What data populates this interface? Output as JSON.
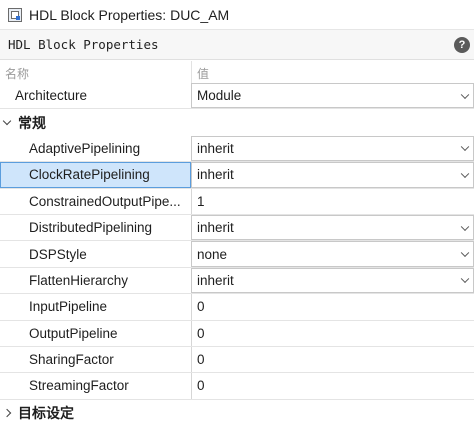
{
  "window": {
    "title": "HDL Block Properties: DUC_AM",
    "icon": "block-properties-app-icon"
  },
  "dialog": {
    "heading": "HDL Block Properties",
    "help_icon": "help-question-icon",
    "help_glyph": "?"
  },
  "columns": {
    "name": "名称",
    "value": "值"
  },
  "top_rows": [
    {
      "name": "Architecture",
      "value": "Module",
      "dropdown": true
    }
  ],
  "categories": [
    {
      "label": "常规",
      "expanded": true,
      "rows": [
        {
          "name": "AdaptivePipelining",
          "value": "inherit",
          "dropdown": true
        },
        {
          "name": "ClockRatePipelining",
          "value": "inherit",
          "dropdown": true,
          "selected": true
        },
        {
          "name": "ConstrainedOutputPipe...",
          "value": "1",
          "dropdown": false
        },
        {
          "name": "DistributedPipelining",
          "value": "inherit",
          "dropdown": true
        },
        {
          "name": "DSPStyle",
          "value": "none",
          "dropdown": true
        },
        {
          "name": "FlattenHierarchy",
          "value": "inherit",
          "dropdown": true
        },
        {
          "name": "InputPipeline",
          "value": "0",
          "dropdown": false
        },
        {
          "name": "OutputPipeline",
          "value": "0",
          "dropdown": false
        },
        {
          "name": "SharingFactor",
          "value": "0",
          "dropdown": false
        },
        {
          "name": "StreamingFactor",
          "value": "0",
          "dropdown": false
        }
      ]
    },
    {
      "label": "目标设定",
      "expanded": false,
      "rows": []
    }
  ],
  "colors": {
    "selection": "#cfe5fb",
    "selection_border": "#5b9ddd",
    "help_icon": "#5b5b5b"
  }
}
